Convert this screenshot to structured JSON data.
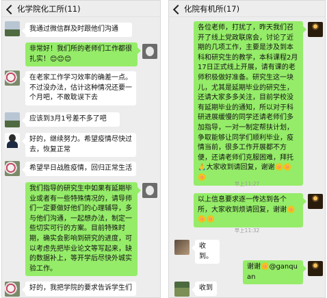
{
  "left": {
    "title": "化学院化工所(11)",
    "messages": [
      {
        "dir": "in",
        "avatar": "landscape-avatar",
        "text": "我通过微信群及时跟他们沟通"
      },
      {
        "dir": "out",
        "avatar": "sheep-avatar",
        "text": "非常好！我们所的老师们工作都很扎实！😊😊😊"
      },
      {
        "dir": "in",
        "avatar": "flower-avatar",
        "text": "在老家工作学习效率的确差一点。不过没办法，估计这种情况还要一个月吧，不敢耽误下去"
      },
      {
        "dir": "in",
        "avatar": "landscape-avatar",
        "text": "应该到3月1号差不多了吧"
      },
      {
        "dir": "in",
        "avatar": "man-avatar",
        "text": "好的，继续努力。希望疫情尽快过去，恢复正常"
      },
      {
        "dir": "in",
        "avatar": "flower-avatar",
        "text": "希望早日战胜疫情，回归正常生活"
      },
      {
        "dir": "out",
        "avatar": "sheep-avatar",
        "text": "我们指导的研究生中如果有延期毕业或者有一些特殊情况的，请导师们一定要做好他们的心理辅导，多与他们沟通，一起想办法，制定一些切实可行的方案。目前特殊时期，确实会影响到研究的进度，可以考虑先把毕业论文等写起来，缺的数据补上，等开学后尽快外城实验工作。"
      },
      {
        "dir": "in",
        "avatar": "flower-avatar",
        "text": "好的，我把学院的要求告诉学生们"
      }
    ]
  },
  "right": {
    "title": "化院有机所(17)",
    "msg1": {
      "dir": "out",
      "avatar": "candle-avatar",
      "text": "各位老师，打扰了，昨天我们召开了线上党政联席会，讨论了近期的几项工作，主要是涉及到本科和研究生的教学，本科课程2月17日正式线上开展，请有课的老师积极做好准备。研究生这一块儿，尤其是延期毕业的研究生，还请大家多多关注，目前学校没有延期毕业的通知，所以对于科研进展缓慢的同学还请老师们多加指导，一对一制定帮扶计划，争取能够让同学们顺利毕业，疫情当前，很多工作开展都不方便，还请老师们克服困难，拜托🙏大家收到请回复，谢谢🌼🌼🌼"
    },
    "ts1": "早上11:27",
    "msg2": {
      "dir": "out",
      "avatar": "candle-avatar",
      "text": "以上信息要求逐一传达到各个所，大家收到烦请回复，谢谢🌼🌼🌼"
    },
    "ts2": "早上11:32",
    "msg3": {
      "dir": "in",
      "avatar": "pet-avatar",
      "text": "收到。"
    },
    "msg4": {
      "dir": "out",
      "avatar": "candle-avatar",
      "text": "谢谢🌼@ganquan"
    },
    "msg5": {
      "dir": "in",
      "avatar": "garden-avatar",
      "text": "收到"
    }
  }
}
